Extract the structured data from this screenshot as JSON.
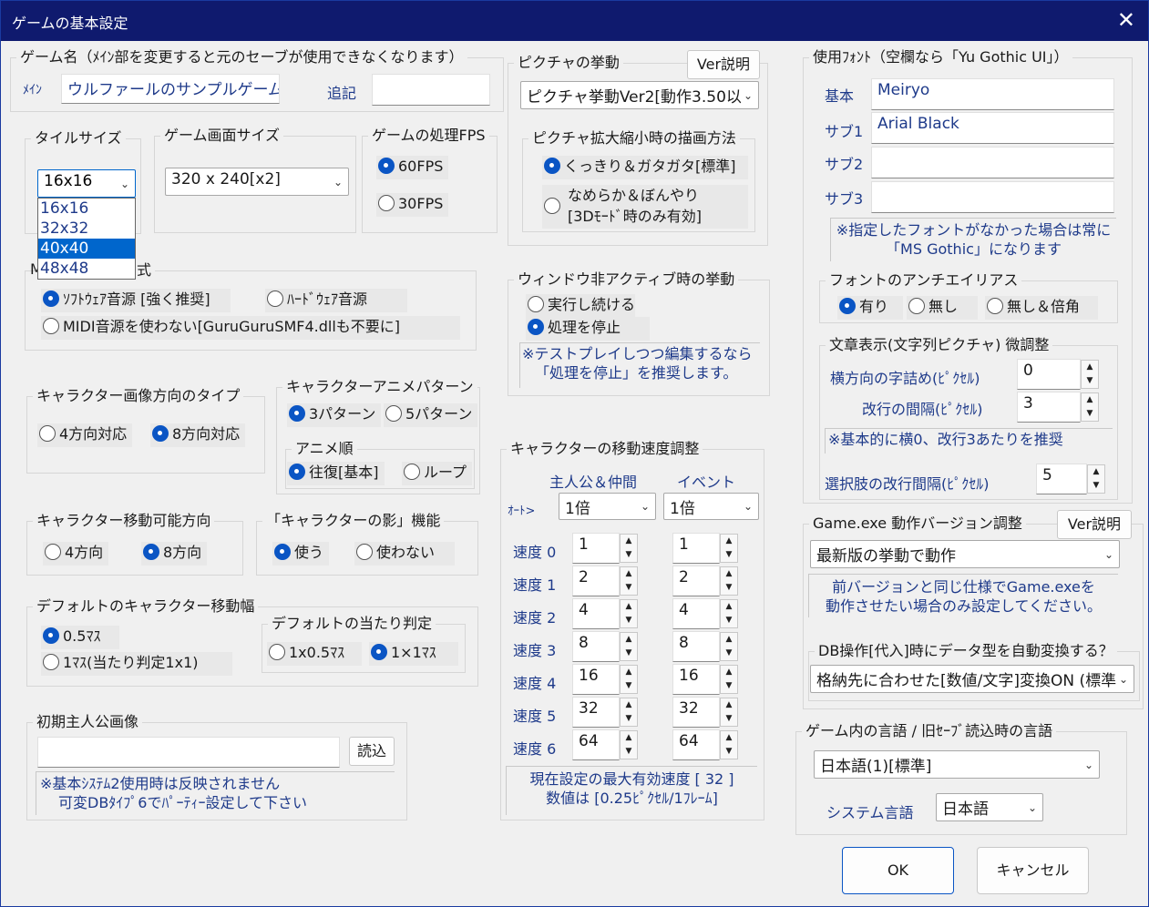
{
  "window": {
    "title": "ゲームの基本設定",
    "close": "✕"
  },
  "game_name": {
    "legend": "ゲーム名（ﾒｲﾝ部を変更すると元のセーブが使用できなくなります）",
    "main_label": "ﾒｲﾝ",
    "main_value": "ウルファールのサンプルゲーム",
    "extra_label": "追記",
    "extra_value": ""
  },
  "tile": {
    "legend": "タイルサイズ",
    "selected": "16x16",
    "options": [
      "16x16",
      "32x32",
      "40x40",
      "48x48"
    ],
    "highlighted": "40x40"
  },
  "screen": {
    "legend": "ゲーム画面サイズ",
    "value": "320 x 240[x2]"
  },
  "fps": {
    "legend": "ゲームの処理FPS",
    "opt1": "60FPS",
    "opt2": "30FPS"
  },
  "midi": {
    "legend_suffix": "式",
    "opt1": "ｿﾌﾄｳｪｱ音源 [強く推奨]",
    "opt2": "ﾊｰﾄﾞｳｪｱ音源",
    "opt3": "MIDI音源を使わない[GuruGuruSMF4.dllも不要に]"
  },
  "char_dir_type": {
    "legend": "キャラクター画像方向のタイプ",
    "opt1": "4方向対応",
    "opt2": "8方向対応"
  },
  "char_anim": {
    "legend": "キャラクターアニメパターン",
    "opt1": "3パターン",
    "opt2": "5パターン",
    "order_legend": "アニメ順",
    "order1": "往復[基本]",
    "order2": "ループ"
  },
  "char_move_dir": {
    "legend": "キャラクター移動可能方向",
    "opt1": "4方向",
    "opt2": "8方向"
  },
  "char_shadow": {
    "legend": "「キャラクターの影」機能",
    "opt1": "使う",
    "opt2": "使わない"
  },
  "move_width": {
    "legend": "デフォルトのキャラクター移動幅",
    "opt1": "0.5ﾏｽ",
    "opt2": "1ﾏｽ(当たり判定1x1)"
  },
  "hit": {
    "legend": "デフォルトの当たり判定",
    "opt1": "1x0.5ﾏｽ",
    "opt2": "1×1ﾏｽ"
  },
  "hero": {
    "legend": "初期主人公画像",
    "value": "",
    "load": "読込",
    "note1": "※基本ｼｽﾃﾑ2使用時は反映されません",
    "note2": "可変DBﾀｲﾌﾟ6でﾊﾟｰﾃｨｰ設定して下さい"
  },
  "picture": {
    "legend": "ピクチャの挙動",
    "ver": "Ver説明",
    "value": "ピクチャ挙動Ver2[動作3.50以",
    "scale_legend": "ピクチャ拡大縮小時の描画方法",
    "opt1": "くっきり＆ガタガタ[標準]",
    "opt2a": "なめらか＆ぼんやり",
    "opt2b": "[3Dﾓｰﾄﾞ時のみ有効]"
  },
  "inactive": {
    "legend": "ウィンドウ非アクティブ時の挙動",
    "opt1": "実行し続ける",
    "opt2": "処理を停止",
    "note1": "※テストプレイしつつ編集するなら",
    "note2": "「処理を停止」を推奨します。"
  },
  "speed": {
    "legend": "キャラクターの移動速度調整",
    "col1": "主人公＆仲間",
    "col2": "イベント",
    "auto": "ｵｰﾄ>",
    "auto1": "1倍",
    "auto2": "1倍",
    "rows": [
      {
        "label": "速度 0",
        "v1": "1",
        "v2": "1"
      },
      {
        "label": "速度 1",
        "v1": "2",
        "v2": "2"
      },
      {
        "label": "速度 2",
        "v1": "4",
        "v2": "4"
      },
      {
        "label": "速度 3",
        "v1": "8",
        "v2": "8"
      },
      {
        "label": "速度 4",
        "v1": "16",
        "v2": "16"
      },
      {
        "label": "速度 5",
        "v1": "32",
        "v2": "32"
      },
      {
        "label": "速度 6",
        "v1": "64",
        "v2": "64"
      }
    ],
    "note1": "現在設定の最大有効速度 [ 32 ]",
    "note2": "数値は [0.25ﾋﾟｸｾﾙ/1ﾌﾚｰﾑ]"
  },
  "font": {
    "legend": "使用ﾌｫﾝﾄ（空欄なら「Yu Gothic UI」）",
    "base_label": "基本",
    "base": "Meiryo",
    "sub1_label": "サブ1",
    "sub1": "Arial Black",
    "sub2_label": "サブ2",
    "sub2": "",
    "sub3_label": "サブ3",
    "sub3": "",
    "note1": "※指定したフォントがなかった場合は常に",
    "note2": "「MS Gothic」になります"
  },
  "aa": {
    "legend": "フォントのアンチエイリアス",
    "opt1": "有り",
    "opt2": "無し",
    "opt3": "無し＆倍角"
  },
  "text": {
    "legend": "文章表示(文字列ピクチャ) 微調整",
    "h_label": "横方向の字詰め(ﾋﾟｸｾﾙ)",
    "h_value": "0",
    "v_label": "改行の間隔(ﾋﾟｸｾﾙ)",
    "v_value": "3",
    "note": "※基本的に横0、改行3あたりを推奨",
    "choice_label": "選択肢の改行間隔(ﾋﾟｸｾﾙ)",
    "choice_value": "5"
  },
  "gameexe": {
    "legend": "Game.exe 動作バージョン調整",
    "ver": "Ver説明",
    "value": "最新版の挙動で動作",
    "note1": "前バージョンと同じ仕様でGame.exeを",
    "note2": "動作させたい場合のみ設定してください。",
    "db_legend": "DB操作[代入]時にデータ型を自動変換する？",
    "db_value": "格納先に合わせた[数値/文字]変換ON (標準)"
  },
  "lang": {
    "legend": "ゲーム内の言語 / 旧ｾｰﾌﾞ読込時の言語",
    "value": "日本語(1)[標準]",
    "sys_label": "システム言語",
    "sys_value": "日本語"
  },
  "buttons": {
    "ok": "OK",
    "cancel": "キャンセル"
  }
}
